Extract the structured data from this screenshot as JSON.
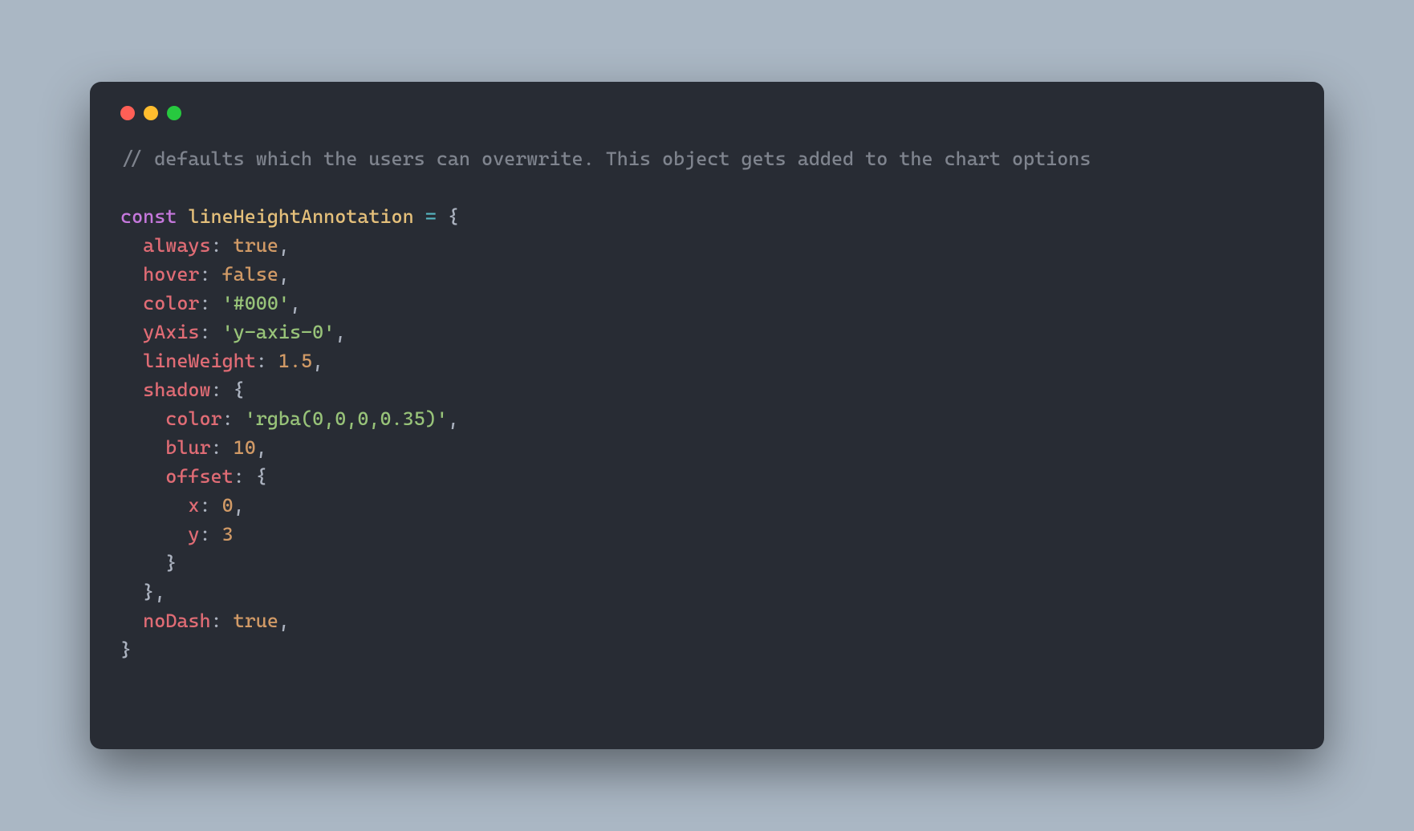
{
  "titlebar": {
    "dots": [
      "red",
      "yellow",
      "green"
    ]
  },
  "code": {
    "comment": "// defaults which the users can overwrite. This object gets added to the chart options",
    "kw_const": "const",
    "var_name": "lineHeightAnnotation",
    "eq": " = ",
    "brace_open": "{",
    "brace_close": "}",
    "comma": ",",
    "colon": ":",
    "space": " ",
    "indent1": "  ",
    "indent2": "    ",
    "indent3": "      ",
    "props": {
      "always": "always",
      "hover": "hover",
      "color": "color",
      "yAxis": "yAxis",
      "lineWeight": "lineWeight",
      "shadow": "shadow",
      "blur": "blur",
      "offset": "offset",
      "x": "x",
      "y": "y",
      "noDash": "noDash"
    },
    "vals": {
      "true": "true",
      "false": "false",
      "hash000": "'#000'",
      "yaxis0": "'y-axis-0'",
      "one_five": "1.5",
      "rgba": "'rgba(0,0,0,0.35)'",
      "ten": "10",
      "zero": "0",
      "three": "3"
    }
  }
}
